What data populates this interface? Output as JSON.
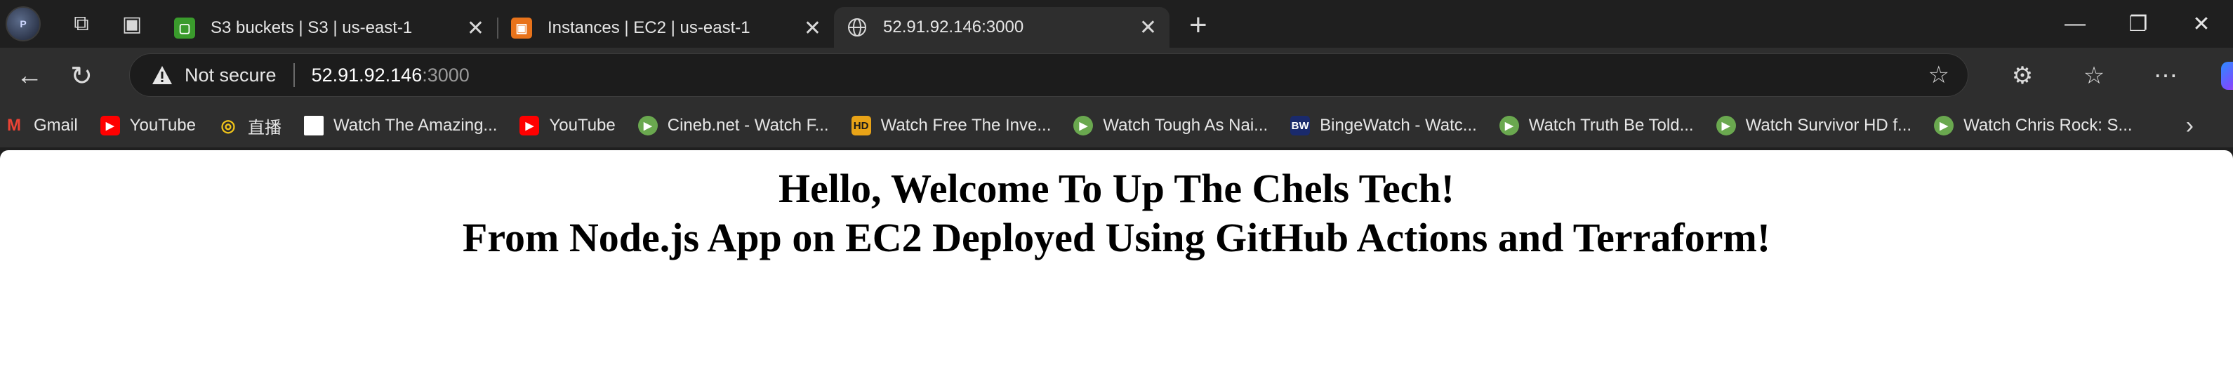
{
  "tabs": [
    {
      "label": "S3 buckets | S3 | us-east-1",
      "favicon": "s3-icon",
      "color": "#3a9b2c"
    },
    {
      "label": "Instances | EC2 | us-east-1",
      "favicon": "ec2-icon",
      "color": "#e8731b"
    },
    {
      "label": "52.91.92.146:3000",
      "favicon": "globe-icon",
      "active": true
    }
  ],
  "toolbar": {
    "security_label": "Not secure",
    "url_host": "52.91.92.146",
    "url_port": ":3000"
  },
  "bookmarks": [
    {
      "label": "Gmail",
      "icon": "gmail-icon",
      "color": "#ea4335"
    },
    {
      "label": "YouTube",
      "icon": "youtube-icon",
      "color": "#ff0000"
    },
    {
      "label": "直播",
      "icon": "live-icon",
      "color": "#f0c419"
    },
    {
      "label": "Watch The Amazing...",
      "icon": "page-icon",
      "color": "#ffffff"
    },
    {
      "label": "YouTube",
      "icon": "youtube-icon",
      "color": "#ff0000"
    },
    {
      "label": "Cineb.net - Watch F...",
      "icon": "play-icon",
      "color": "#6aa84f"
    },
    {
      "label": "Watch Free The Inve...",
      "icon": "hd-icon",
      "color": "#e8a317"
    },
    {
      "label": "Watch Tough As Nai...",
      "icon": "play-icon",
      "color": "#6aa84f"
    },
    {
      "label": "BingeWatch - Watc...",
      "icon": "bw-icon",
      "color": "#1a2a6c"
    },
    {
      "label": "Watch Truth Be Told...",
      "icon": "play-icon",
      "color": "#6aa84f"
    },
    {
      "label": "Watch Survivor HD f...",
      "icon": "play-icon",
      "color": "#6aa84f"
    },
    {
      "label": "Watch Chris Rock: S...",
      "icon": "play-icon",
      "color": "#6aa84f"
    }
  ],
  "page": {
    "line1": "Hello, Welcome To Up The Chels Tech!",
    "line2": "From Node.js App on EC2 Deployed Using GitHub Actions and Terraform!"
  }
}
